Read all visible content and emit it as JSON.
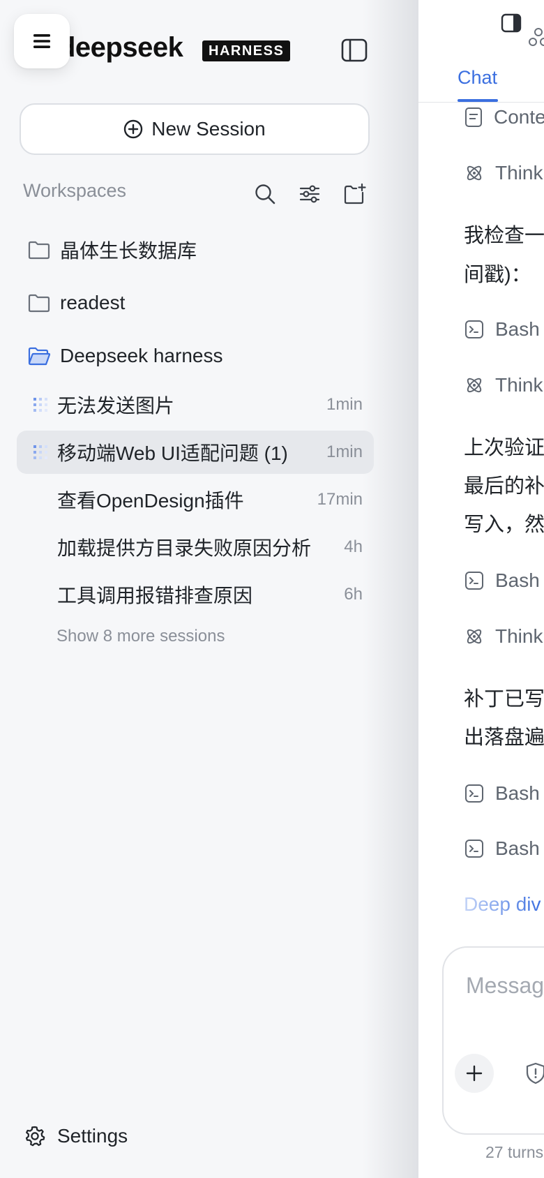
{
  "sidebar": {
    "brand_name": "deepseek",
    "brand_badge": "HARNESS",
    "new_session_label": "New Session",
    "workspaces_label": "Workspaces",
    "workspaces": [
      {
        "label": "晶体生长数据库",
        "icon": "folder-icon",
        "open": false
      },
      {
        "label": "readest",
        "icon": "folder-icon",
        "open": false
      },
      {
        "label": "Deepseek harness",
        "icon": "folder-open-icon",
        "open": true
      }
    ],
    "sessions": [
      {
        "title": "无法发送图片",
        "time": "1min",
        "running": true,
        "active": false
      },
      {
        "title": "移动端Web UI适配问题 (1)",
        "time": "1min",
        "running": true,
        "active": true
      },
      {
        "title": "查看OpenDesign插件",
        "time": "17min",
        "running": false,
        "active": false
      },
      {
        "title": "加载提供方目录失败原因分析",
        "time": "4h",
        "running": false,
        "active": false
      },
      {
        "title": "工具调用报错排查原因",
        "time": "6h",
        "running": false,
        "active": false
      }
    ],
    "show_more_label": "Show 8 more sessions",
    "settings_label": "Settings"
  },
  "main": {
    "tab_active": "Chat",
    "timeline": {
      "tool_content": "Conte",
      "tool_think": "Think",
      "tool_bash": "Bash",
      "msg1_line1": "我检查一",
      "msg1_line2": "间戳)：",
      "msg2_line1": "上次验证",
      "msg2_line2": "最后的补",
      "msg2_line3": "写入，然",
      "msg3_line1": "补丁已写",
      "msg3_line2": "出落盘遍",
      "deep_dive": "Deep div"
    },
    "composer_placeholder": "Messag",
    "footer_stats": "27 turns"
  },
  "colors": {
    "accent": "#3b6fe0",
    "sidebar_bg": "#f6f7f9",
    "active_row": "#e6e8ec",
    "muted_text": "#8a8f98"
  }
}
